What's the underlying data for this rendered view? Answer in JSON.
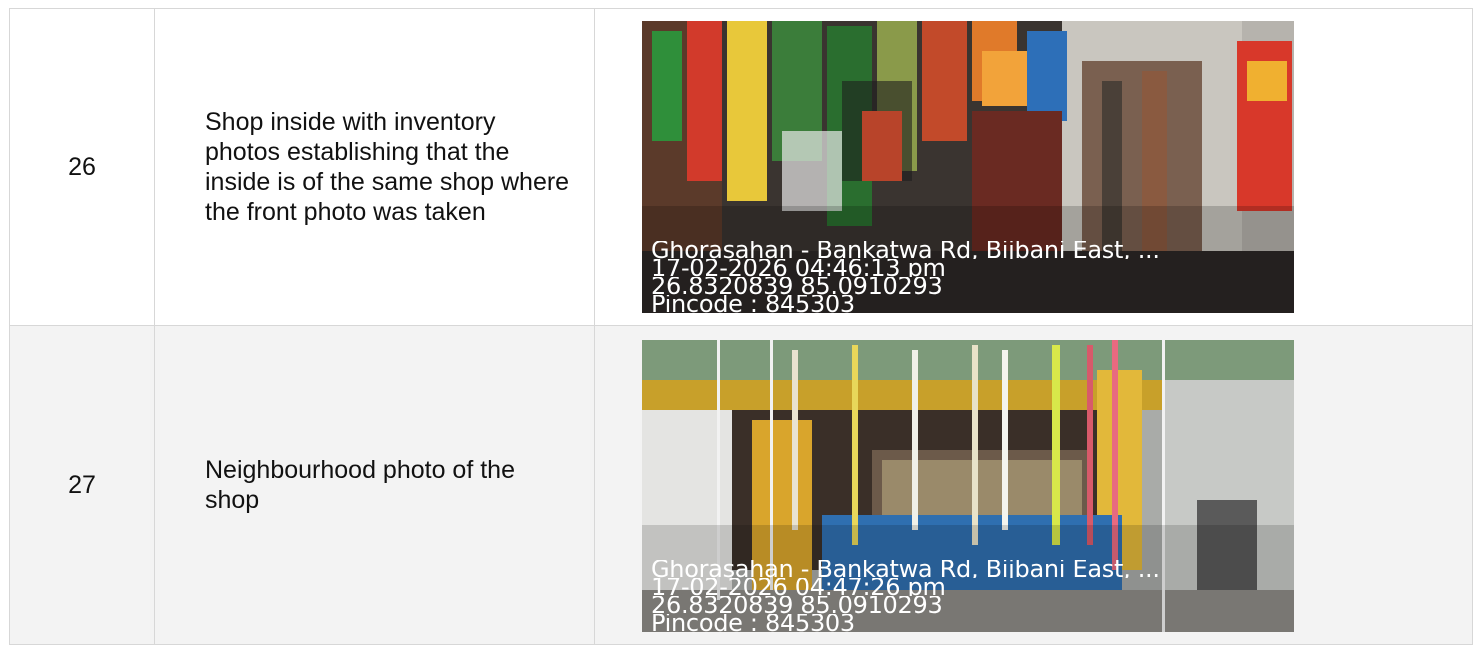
{
  "rows": [
    {
      "number": "26",
      "description": "Shop inside with inventory photos establishing that the inside is of the same shop where the front photo was taken",
      "photo": {
        "address": "Ghorasahan - Bankatwa Rd, Bijbani East, ...",
        "timestamp": "17-02-2026 04:46:13 pm",
        "coordinates": "26.8320839 85.0910293",
        "pincode": "Pincode : 845303"
      }
    },
    {
      "number": "27",
      "description": "Neighbourhood photo of the shop",
      "photo": {
        "address": "Ghorasahan - Bankatwa Rd, Bijbani East, ...",
        "timestamp": "17-02-2026 04:47:26 pm",
        "coordinates": "26.8320839 85.0910293",
        "pincode": "Pincode : 845303"
      }
    }
  ]
}
